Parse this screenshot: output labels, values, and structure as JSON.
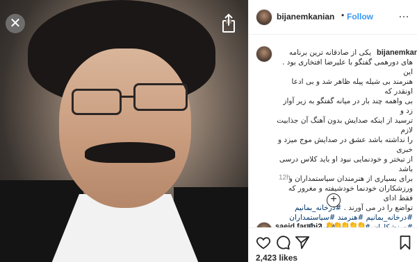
{
  "post": {
    "username": "bijanemkanian",
    "follow_label": "Follow",
    "separator": "•",
    "more_icon": "…",
    "caption_lines": [
      "یکی از صادقانه ترین برنامه",
      "های دورهمی گفتگو با علیرضا افتخاری بود . این",
      "هنرمند بی شیله پیله ظاهر شد و بی ادعا اونقدر که",
      "بی واهمه چند بار در میانه گفتگو به زیر آواز زد و",
      "ترسید از اینکه صدایش بدون آهنگ آن جذابیت لازم",
      "را نداشته باشد عشق در صدایش موج میزد و خبری",
      "از تبختر و خودنمایی نبود او باید کلاس درسی باشد",
      "برای بسیاری از هنرمندان سیاستمداران و",
      "ورزشکاران خودنما خودشیفته و مغرور که فقط اداى",
      "تواضع را در مى آورند ."
    ],
    "hashtags": "#درخانه_بمانیم #درخانه_بمانیم #هنرمند #سیاستمداران #ورزشکاران #بازیگران #خوانندگان #علیرضا_افتخاری #مردم_ایران",
    "time": "12h",
    "comment": {
      "username": "saeid.farahi2",
      "emoji": "👏👏👏👏👏"
    },
    "likes": "2,423 likes"
  },
  "icons": {
    "close": "close-icon",
    "share": "share-icon",
    "add": "add-comment-icon",
    "heart": "heart-icon",
    "comment": "comment-icon",
    "send": "send-icon",
    "bookmark": "bookmark-icon"
  },
  "colors": {
    "follow": "#3897f0",
    "hashtag": "#003569"
  }
}
